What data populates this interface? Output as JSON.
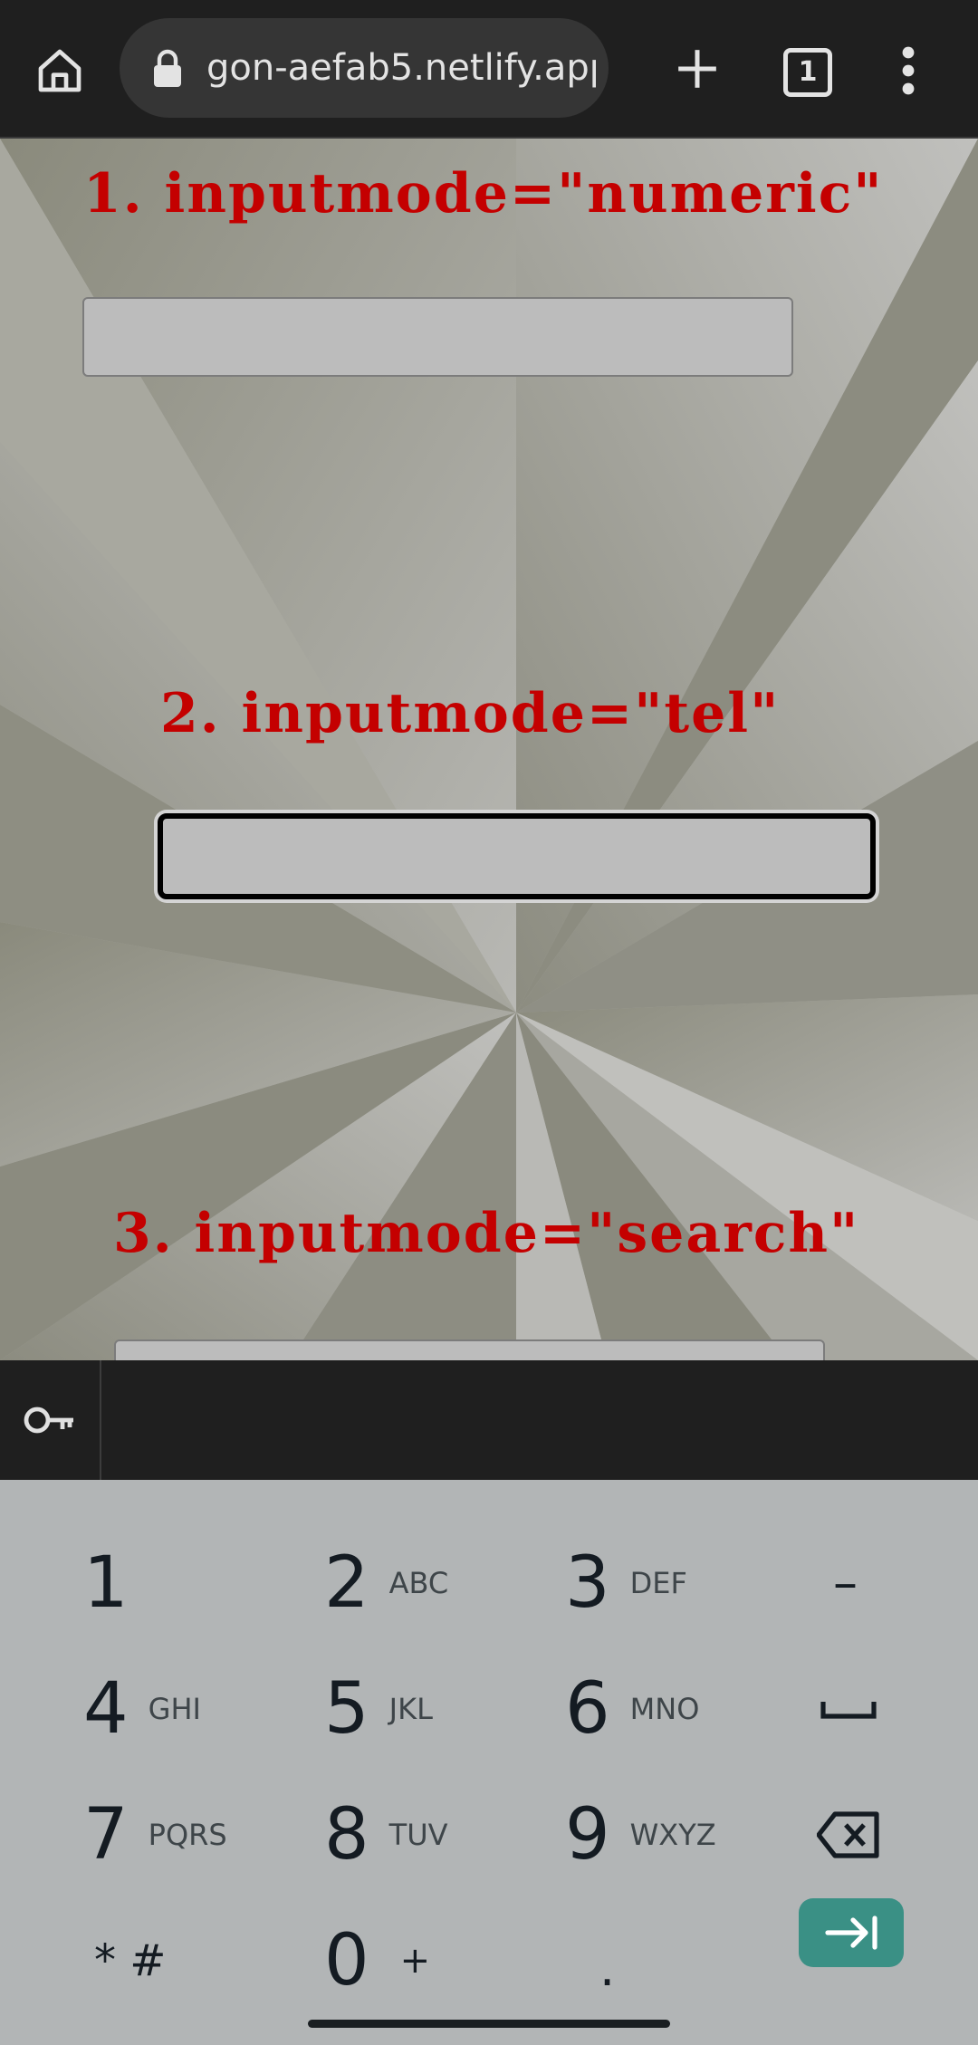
{
  "browser": {
    "url": "gon-aefab5.netlify.app",
    "tab_count": "1",
    "colors": {
      "toolbar": "#1f1f1f",
      "url_pill": "#353535",
      "text": "#e3e3e3"
    },
    "icons": [
      "home-icon",
      "lock-icon",
      "new-tab-icon",
      "tab-switcher-icon",
      "more-menu-icon"
    ]
  },
  "page": {
    "sections": [
      {
        "heading": "1. inputmode=\"numeric\"",
        "value": ""
      },
      {
        "heading": "2. inputmode=\"tel\"",
        "value": ""
      },
      {
        "heading": "3. inputmode=\"search\"",
        "value": ""
      }
    ],
    "focused_section": 2,
    "heading_color": "#c40000"
  },
  "autofill_bar": {
    "icon": "key-icon"
  },
  "keyboard": {
    "type": "phone-dialpad",
    "rows": [
      [
        {
          "num": "1",
          "letters": ""
        },
        {
          "num": "2",
          "letters": "ABC"
        },
        {
          "num": "3",
          "letters": "DEF"
        },
        {
          "sym": "–"
        }
      ],
      [
        {
          "num": "4",
          "letters": "GHI"
        },
        {
          "num": "5",
          "letters": "JKL"
        },
        {
          "num": "6",
          "letters": "MNO"
        },
        {
          "icon": "space-icon"
        }
      ],
      [
        {
          "num": "7",
          "letters": "PQRS"
        },
        {
          "num": "8",
          "letters": "TUV"
        },
        {
          "num": "9",
          "letters": "WXYZ"
        },
        {
          "icon": "backspace-icon"
        }
      ],
      [
        {
          "sym": "* #"
        },
        {
          "num": "0",
          "letters": "+"
        },
        {
          "sym": "."
        },
        {
          "icon": "next-field-icon"
        }
      ]
    ],
    "accent_color": "#3a9085"
  }
}
